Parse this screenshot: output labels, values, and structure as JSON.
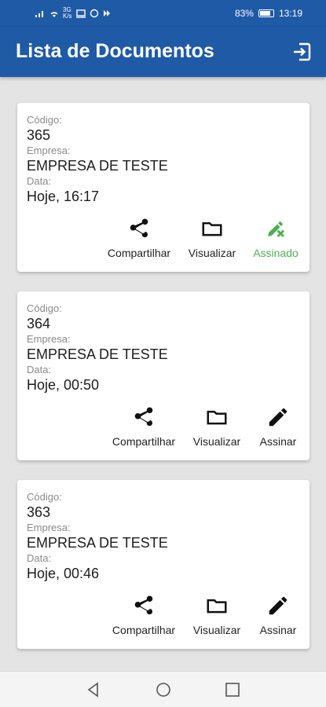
{
  "status_bar": {
    "network": "3G",
    "speed": "K/s",
    "battery": "83%",
    "time": "13:19"
  },
  "app_bar": {
    "title": "Lista de Documentos",
    "logout_icon": "logout-icon"
  },
  "labels": {
    "codigo": "Código:",
    "empresa": "Empresa:",
    "data": "Data:"
  },
  "documents": [
    {
      "codigo": "365",
      "empresa": "EMPRESA DE TESTE",
      "data": "Hoje, 16:17",
      "actions": {
        "share": "Compartilhar",
        "view": "Visualizar",
        "sign": "Assinado"
      },
      "signed": true
    },
    {
      "codigo": "364",
      "empresa": "EMPRESA DE TESTE",
      "data": "Hoje, 00:50",
      "actions": {
        "share": "Compartilhar",
        "view": "Visualizar",
        "sign": "Assinar"
      },
      "signed": false
    },
    {
      "codigo": "363",
      "empresa": "EMPRESA DE TESTE",
      "data": "Hoje, 00:46",
      "actions": {
        "share": "Compartilhar",
        "view": "Visualizar",
        "sign": "Assinar"
      },
      "signed": false
    }
  ],
  "colors": {
    "primary": "#1f5aa6",
    "signed": "#4caf50",
    "background": "#e4e4e4"
  }
}
